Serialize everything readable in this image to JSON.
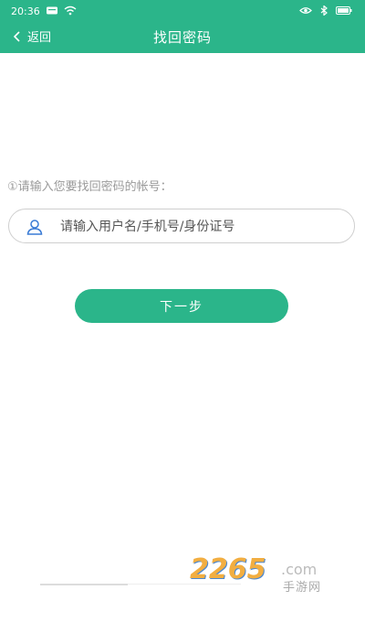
{
  "status_bar": {
    "time": "20:36",
    "left_icons": [
      "message-icon",
      "wifi-icon"
    ],
    "right_icons": [
      "eye-icon",
      "bluetooth-icon",
      "battery-icon"
    ]
  },
  "nav": {
    "back_label": "返回",
    "title": "找回密码"
  },
  "form": {
    "prompt": "①请输入您要找回密码的帐号：",
    "account_field": {
      "value": "",
      "placeholder": "请输入用户名/手机号/身份证号"
    },
    "next_label": "下一步"
  },
  "watermark": {
    "number": "2265",
    "com": ".com",
    "sub": "手游网"
  },
  "colors": {
    "accent": "#2bb58a",
    "text_muted": "#9a9a9a",
    "border": "#cfcfcf"
  }
}
